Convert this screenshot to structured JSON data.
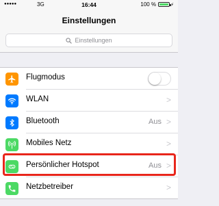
{
  "status_bar": {
    "signal": "●●●●●",
    "carrier": "3G",
    "time": "16:44",
    "battery_percent": "100 %",
    "battery_level": 1.0
  },
  "nav": {
    "title": "Einstellungen"
  },
  "search": {
    "placeholder": "Einstellungen"
  },
  "settings": [
    {
      "label": "Flugmodus",
      "icon": "airplane-icon",
      "color": "#ff9500",
      "control": "toggle",
      "on": false
    },
    {
      "label": "WLAN",
      "icon": "wifi-icon",
      "color": "#007aff",
      "value": "",
      "control": "chevron"
    },
    {
      "label": "Bluetooth",
      "icon": "bluetooth-icon",
      "color": "#007aff",
      "value": "Aus",
      "control": "chevron"
    },
    {
      "label": "Mobiles Netz",
      "icon": "antenna-icon",
      "color": "#4cd964",
      "value": "",
      "control": "chevron"
    },
    {
      "label": "Persönlicher Hotspot",
      "icon": "hotspot-icon",
      "color": "#4cd964",
      "value": "Aus",
      "control": "chevron"
    },
    {
      "label": "Netzbetreiber",
      "icon": "phone-icon",
      "color": "#4cd964",
      "value": "",
      "control": "chevron"
    }
  ],
  "highlight_color": "#e8261b"
}
